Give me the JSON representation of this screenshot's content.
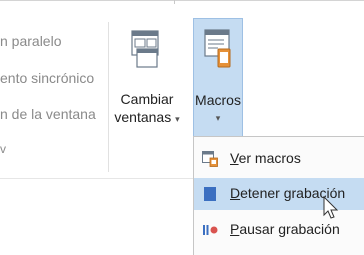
{
  "ribbon": {
    "left_group_rows": [
      "n paralelo",
      "ento sincrónico",
      "n de la ventana",
      "v"
    ],
    "cambiar": {
      "label_line1": "Cambiar",
      "label_line2": "ventanas",
      "caret": "▾",
      "icon": "switch-windows-icon"
    },
    "macros": {
      "label_line1": "Macros",
      "caret": "▾",
      "icon": "macros-icon"
    }
  },
  "menu": {
    "items": [
      {
        "accel": "V",
        "rest": "er macros",
        "icon": "view-macros-icon",
        "highlighted": false
      },
      {
        "accel": "D",
        "rest": "etener grabación",
        "icon": "stop-recording-icon",
        "highlighted": true
      },
      {
        "accel": "P",
        "rest": "ausar grabación",
        "icon": "pause-recording-icon",
        "highlighted": false
      }
    ]
  },
  "colors": {
    "highlight": "#c5dcf2",
    "stop": "#3b6fc1",
    "pause_dot": "#d9534f",
    "orange": "#e69138"
  }
}
